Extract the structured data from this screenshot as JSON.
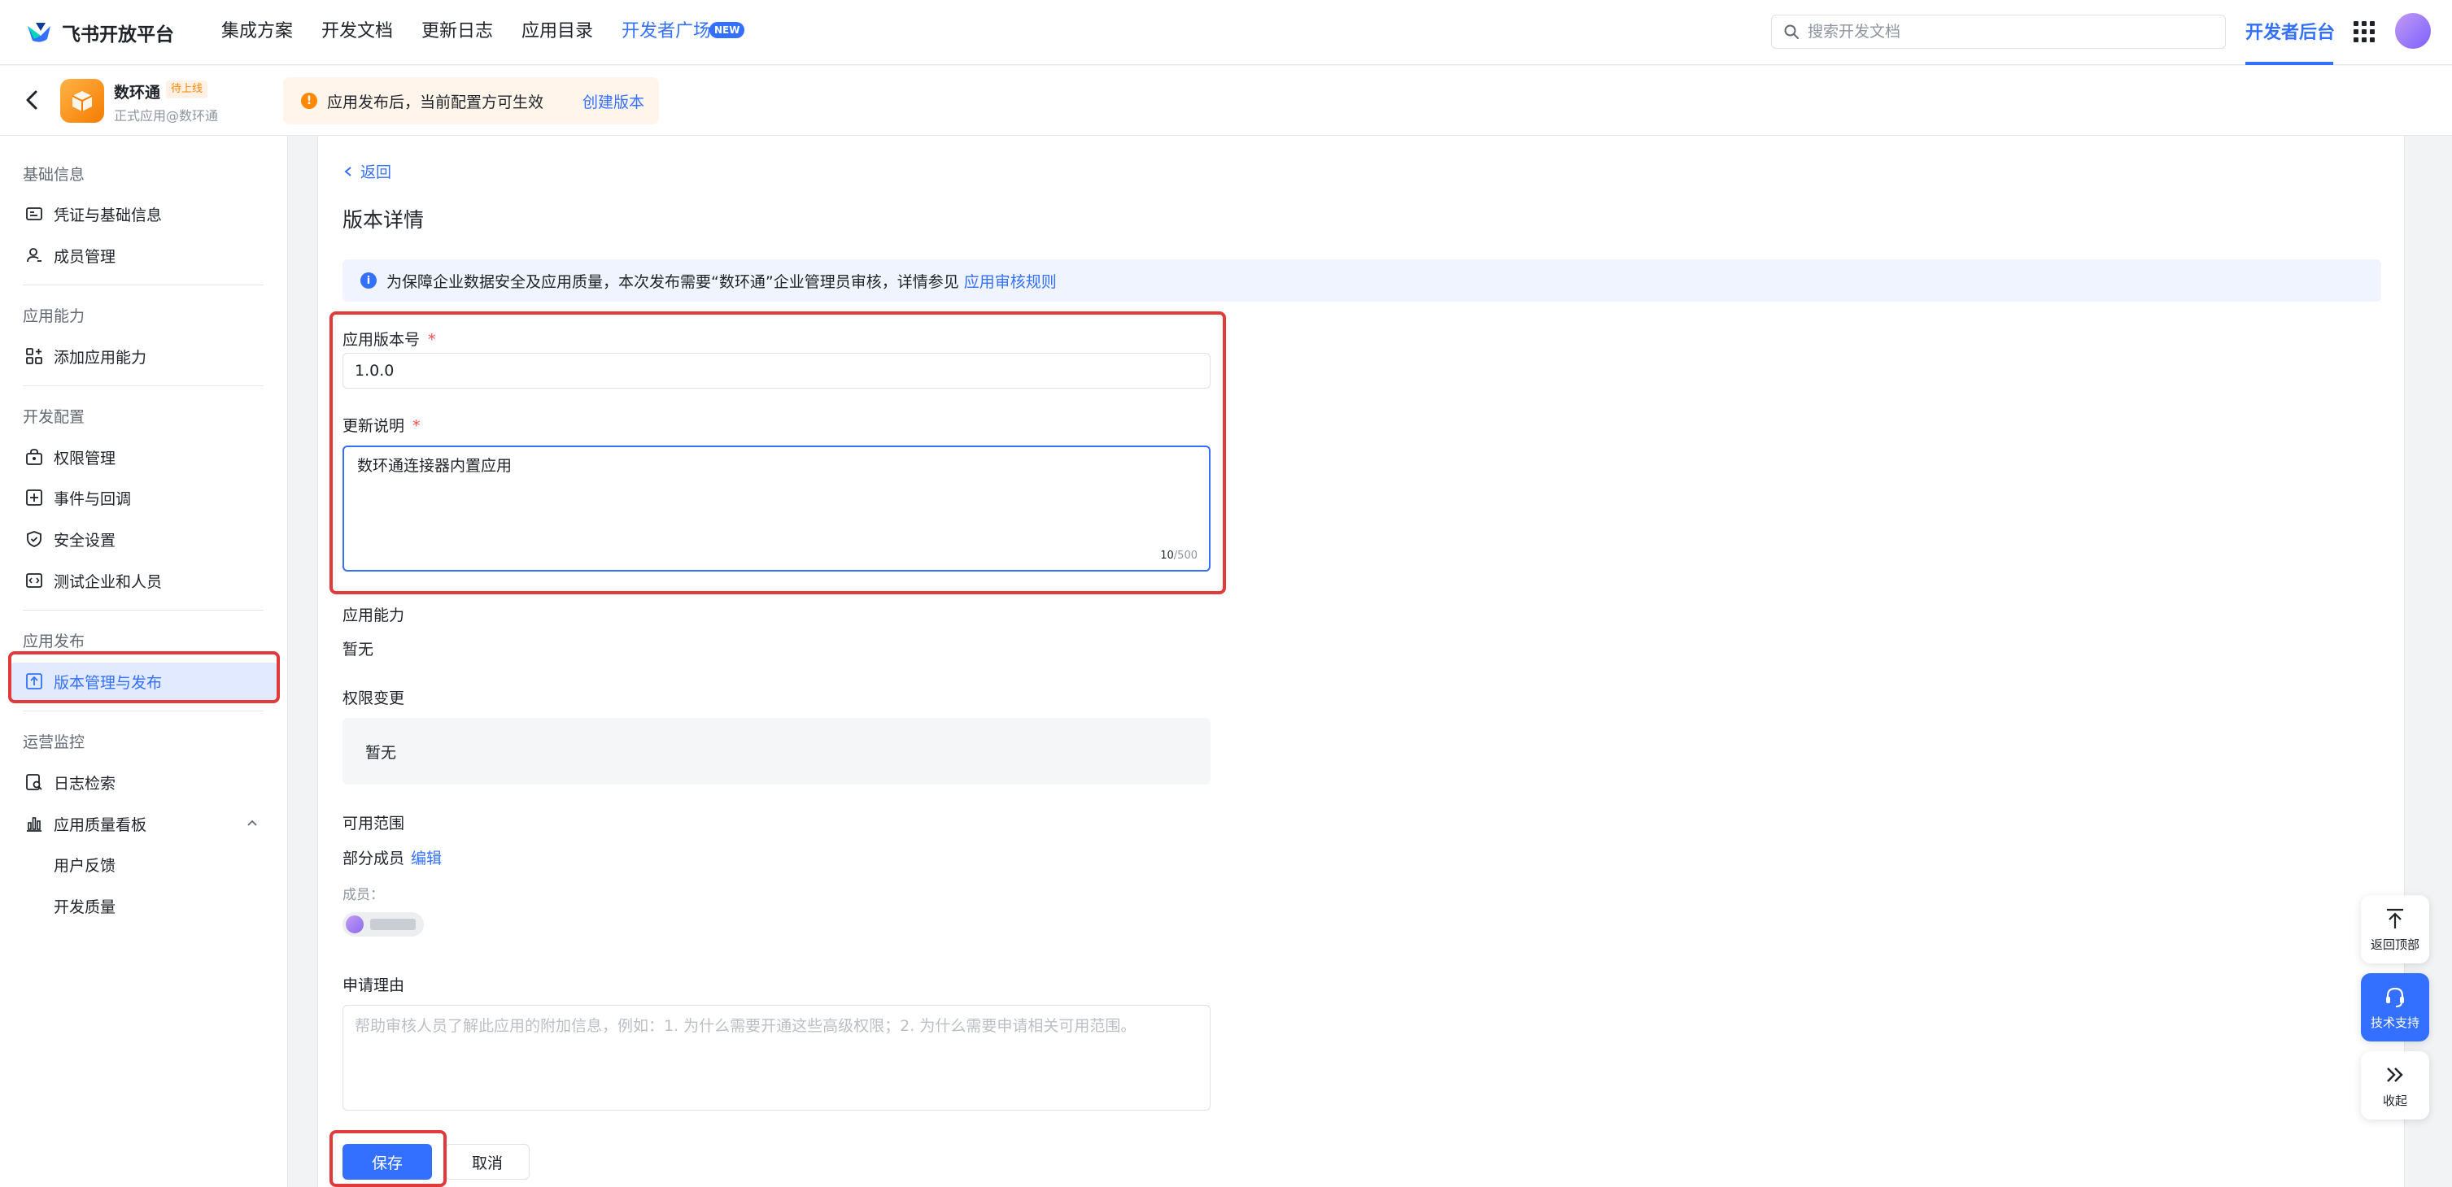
{
  "topnav": {
    "brand": "飞书开放平台",
    "links": [
      "集成方案",
      "开发文档",
      "更新日志",
      "应用目录",
      "开发者广场"
    ],
    "new_badge": "NEW",
    "search_placeholder": "搜索开发文档",
    "console": "开发者后台"
  },
  "app": {
    "name": "数环通",
    "status": "待上线",
    "subtitle": "正式应用@数环通",
    "notice": "应用发布后，当前配置方可生效",
    "notice_link": "创建版本"
  },
  "sidebar": {
    "groups": [
      "基础信息",
      "应用能力",
      "开发配置",
      "应用发布",
      "运营监控"
    ],
    "items": [
      {
        "label": "凭证与基础信息",
        "icon": "credential-icon"
      },
      {
        "label": "成员管理",
        "icon": "member-icon"
      },
      {
        "label": "添加应用能力",
        "icon": "add-capability-icon"
      },
      {
        "label": "权限管理",
        "icon": "permission-icon"
      },
      {
        "label": "事件与回调",
        "icon": "event-icon"
      },
      {
        "label": "安全设置",
        "icon": "shield-icon"
      },
      {
        "label": "测试企业和人员",
        "icon": "test-icon"
      },
      {
        "label": "版本管理与发布",
        "icon": "upload-icon"
      },
      {
        "label": "日志检索",
        "icon": "log-search-icon"
      },
      {
        "label": "应用质量看板",
        "icon": "chart-icon"
      },
      {
        "label": "用户反馈",
        "icon": ""
      },
      {
        "label": "开发质量",
        "icon": ""
      }
    ]
  },
  "main": {
    "back": "返回",
    "title": "版本详情",
    "info": "为保障企业数据安全及应用质量，本次发布需要“数环通”企业管理员审核，详情参见",
    "info_link": "应用审核规则",
    "version_label": "应用版本号",
    "version_value": "1.0.0",
    "notes_label": "更新说明",
    "notes_value": "数环通连接器内置应用",
    "notes_count": "10",
    "notes_max": "/500",
    "capability_label": "应用能力",
    "capability_value": "暂无",
    "perm_label": "权限变更",
    "perm_value": "暂无",
    "scope_label": "可用范围",
    "scope_value": "部分成员",
    "scope_edit": "编辑",
    "members_label": "成员：",
    "reason_label": "申请理由",
    "reason_placeholder": "帮助审核人员了解此应用的附加信息，例如：1. 为什么需要开通这些高级权限；2. 为什么需要申请相关可用范围。",
    "save": "保存",
    "cancel": "取消"
  },
  "float": {
    "top": "返回顶部",
    "support": "技术支持",
    "collapse": "收起"
  },
  "colors": {
    "accent": "#3370ff",
    "highlight": "#e03a3a",
    "warning": "#ff8800"
  }
}
